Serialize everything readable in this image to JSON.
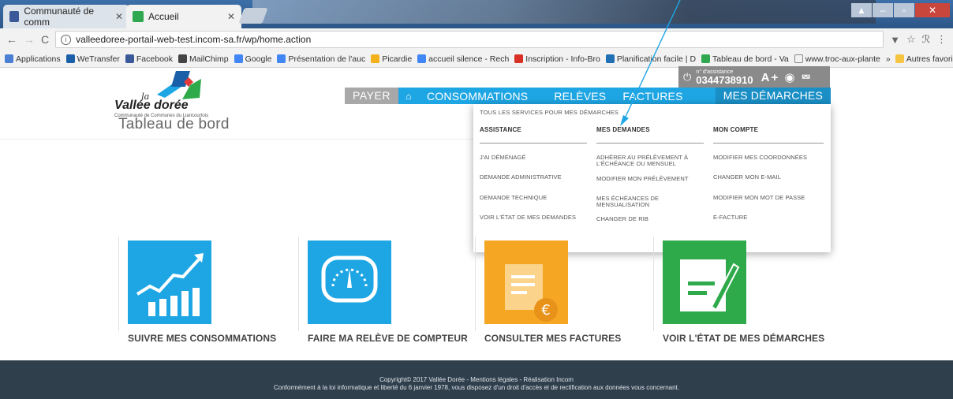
{
  "browser": {
    "tabs": [
      {
        "title": "Communauté de comm",
        "favicon_color": "#3b5998"
      },
      {
        "title": "Accueil",
        "favicon_color": "#2fa84f"
      }
    ],
    "url": "valleedoree-portail-web-test.incom-sa.fr/wp/home.action",
    "bookmarks": [
      "Applications",
      "WeTransfer",
      "Facebook",
      "MailChimp",
      "Google",
      "Présentation de l'auc",
      "Picardie",
      "accueil silence - Rech",
      "Inscription - Info-Bro",
      "Planification facile | D",
      "Tableau de bord - Va",
      "www.troc-aux-plante"
    ],
    "bookmarks_more": "»",
    "other_bookmarks": "Autres favoris"
  },
  "site": {
    "logo": {
      "la": "la",
      "name": "Vallée dorée",
      "subtitle": "Communauté de Communes du Liancourtois"
    },
    "page_title": "Tableau de bord",
    "assistance": {
      "label": "n° d'assistance",
      "number": "0344738910",
      "tools": "A+ ◉ ⮹"
    },
    "nav": {
      "payer": "PAYER",
      "items": [
        "CONSOMMATIONS",
        "RELÈVES",
        "FACTURES",
        "MES DÉMARCHES"
      ]
    },
    "dropdown": {
      "all_services": "TOUS LES SERVICES POUR MES DÉMARCHES",
      "columns": [
        {
          "title": "ASSISTANCE",
          "links": [
            "J'AI DÉMÉNAGÉ",
            "DEMANDE ADMINISTRATIVE",
            "DEMANDE TECHNIQUE",
            "VOIR L'ÉTAT DE MES DEMANDES"
          ]
        },
        {
          "title": "MES DEMANDES",
          "links": [
            "ADHÉRER AU PRÉLÈVEMENT À L'ÉCHÉANCE OU MENSUEL",
            "MODIFIER MON PRÉLÈVEMENT",
            "MES ÉCHÉANCES DE MENSUALISATION",
            "CHANGER DE RIB"
          ]
        },
        {
          "title": "MON COMPTE",
          "links": [
            "MODIFIER MES COORDONNÉES",
            "CHANGER MON E-MAIL",
            "MODIFIER MON MOT DE PASSE",
            "E-FACTURE"
          ]
        }
      ]
    },
    "tiles": [
      {
        "label": "SUIVRE MES CONSOMMATIONS",
        "color": "#1ea6e4"
      },
      {
        "label": "FAIRE MA RELÈVE DE COMPTEUR",
        "color": "#1ea6e4"
      },
      {
        "label": "CONSULTER MES FACTURES",
        "color": "#f5a623"
      },
      {
        "label": "VOIR L'ÉTAT DE MES DÉMARCHES",
        "color": "#2eaa4a"
      }
    ],
    "footer": {
      "line1": "Copyright© 2017 Vallée Dorée  -  Mentions légales  -  Réalisation Incom",
      "line2": "Conformément à la loi informatique et liberté du 6 janvier 1978, vous disposez d'un droit d'accès et de rectification aux données vous concernant."
    }
  }
}
